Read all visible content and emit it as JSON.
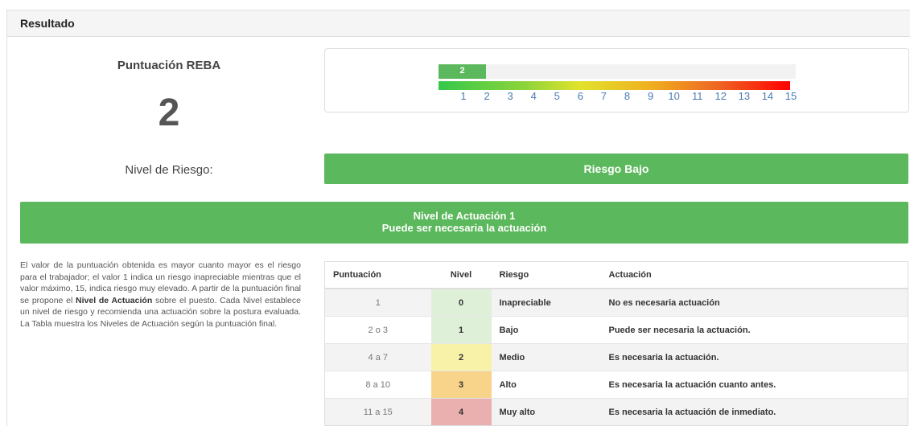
{
  "panel": {
    "title": "Resultado"
  },
  "score": {
    "label": "Puntuación REBA",
    "value": "2"
  },
  "scale": {
    "current_label": "2",
    "current_value": 2,
    "max": 15,
    "ticks": [
      "1",
      "2",
      "3",
      "4",
      "5",
      "6",
      "7",
      "8",
      "9",
      "10",
      "11",
      "12",
      "13",
      "14",
      "15"
    ]
  },
  "risk": {
    "label": "Nivel de Riesgo:",
    "value": "Riesgo Bajo",
    "color": "#5cb85c"
  },
  "action": {
    "line1": "Nivel de Actuación 1",
    "line2": "Puede ser necesaria la actuación",
    "color": "#5cb85c"
  },
  "description": {
    "part1": "El valor de la puntuación obtenida es mayor cuanto mayor es el riesgo para el trabajador; el valor 1 indica un riesgo inapreciable mientras que el valor máximo, 15, indica riesgo muy elevado. A partir de la puntuación final se propone el ",
    "bold": "Nivel de Actuación",
    "part2": " sobre el puesto. Cada Nivel establece un nivel de riesgo y recomienda una actuación sobre la postura evaluada. La Tabla muestra los Niveles de Actuación según la puntuación final."
  },
  "table": {
    "headers": {
      "score": "Puntuación",
      "level": "Nivel",
      "risk": "Riesgo",
      "action": "Actuación"
    },
    "rows": [
      {
        "score": "1",
        "level": "0",
        "risk": "Inapreciable",
        "action": "No es necesaria actuación",
        "level_color": "#dff0d8"
      },
      {
        "score": "2 o 3",
        "level": "1",
        "risk": "Bajo",
        "action": "Puede ser necesaria la actuación.",
        "level_color": "#dff0d8"
      },
      {
        "score": "4 a 7",
        "level": "2",
        "risk": "Medio",
        "action": "Es necesaria la actuación.",
        "level_color": "#f7f2a8"
      },
      {
        "score": "8 a 10",
        "level": "3",
        "risk": "Alto",
        "action": "Es necesaria la actuación cuanto antes.",
        "level_color": "#f7d48a"
      },
      {
        "score": "11 a 15",
        "level": "4",
        "risk": "Muy alto",
        "action": "Es necesaria la actuación de inmediato.",
        "level_color": "#eab0b0"
      }
    ]
  }
}
